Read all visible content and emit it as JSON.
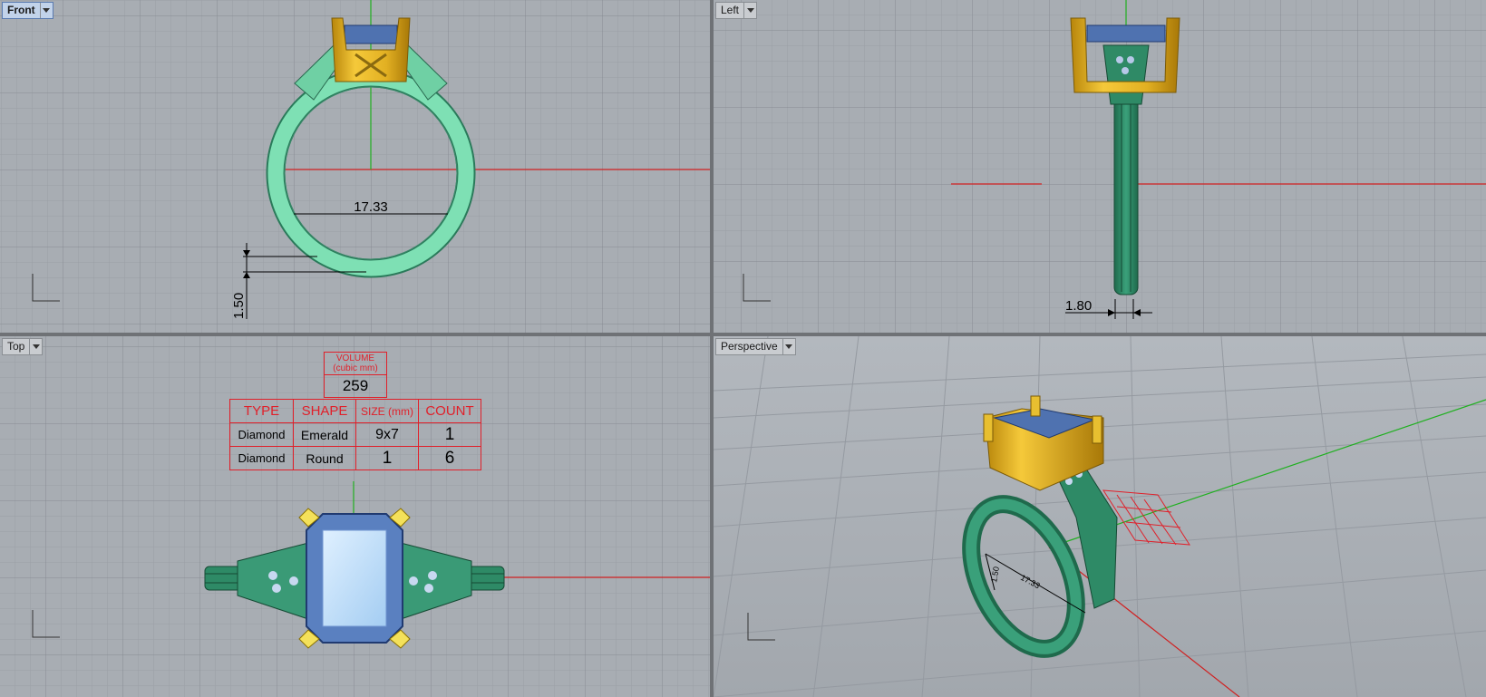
{
  "viewports": {
    "front": {
      "label": "Front",
      "dimension_width": "17.33",
      "dimension_thickness": "1.50"
    },
    "left": {
      "label": "Left",
      "dimension_width": "1.80"
    },
    "top": {
      "label": "Top"
    },
    "perspective": {
      "label": "Perspective",
      "dimension_width": "17.33",
      "dimension_thickness": "1.50"
    }
  },
  "volume_box": {
    "title": "VOLUME",
    "unit": "(cubic mm)",
    "value": "259"
  },
  "stone_table": {
    "headers": [
      "TYPE",
      "SHAPE",
      "SIZE (mm)",
      "COUNT"
    ],
    "rows": [
      [
        "Diamond",
        "Emerald",
        "9x7",
        "1"
      ],
      [
        "Diamond",
        "Round",
        "1",
        "6"
      ]
    ]
  },
  "colors": {
    "viewport_bg": "#a8adb3",
    "grid_minor": "#9a9fa6",
    "grid_major": "#878c93",
    "shank_light": "#7ee0b4",
    "shank_dark": "#2e8a66",
    "gold": "#e0b020",
    "stone": "#5a80c0",
    "stone_light": "#b8dcf8",
    "axis_red": "#d02020",
    "axis_green": "#20b020",
    "table_red": "#e0202a"
  }
}
